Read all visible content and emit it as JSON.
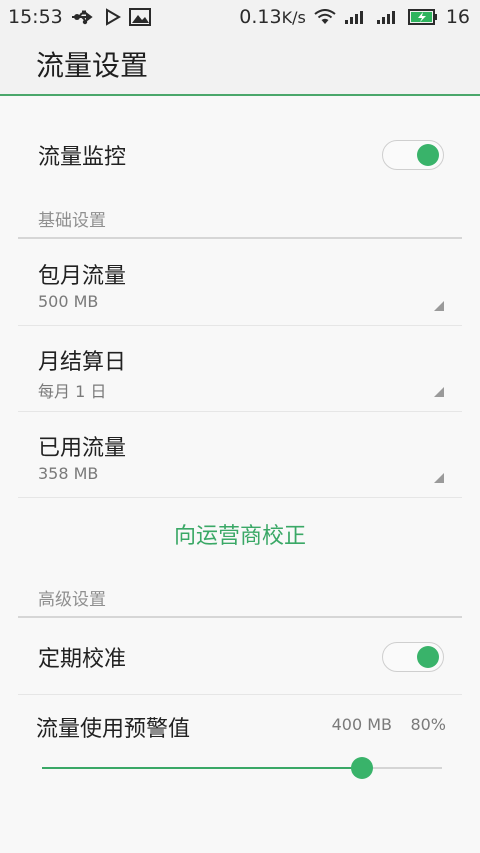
{
  "status_bar": {
    "time": "15:53",
    "speed": "0.13",
    "speed_unit": "K/s",
    "battery": "16",
    "icons": [
      "usb-icon",
      "play-icon",
      "image-icon",
      "wifi-icon",
      "signal-icon",
      "signal-icon",
      "battery-charging-icon"
    ]
  },
  "title": "流量设置",
  "monitoring": {
    "label": "流量监控",
    "enabled": true
  },
  "basic_header": "基础设置",
  "basic_items": [
    {
      "label": "包月流量",
      "value": "500 MB"
    },
    {
      "label": "月结算日",
      "value": "每月 1 日"
    },
    {
      "label": "已用流量",
      "value": "358 MB"
    }
  ],
  "calibrate_label": "向运营商校正",
  "advanced_header": "高级设置",
  "periodic": {
    "label": "定期校准",
    "enabled": true
  },
  "warning": {
    "label": "流量使用预警值",
    "amount": "400 MB",
    "percent": "80%",
    "level": 0.8
  },
  "accent_color": "#3aa866"
}
